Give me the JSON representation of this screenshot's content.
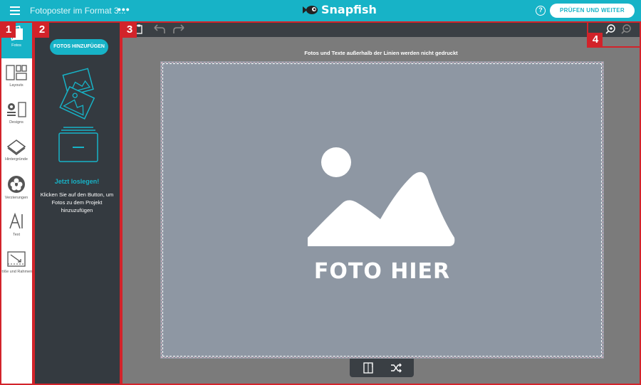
{
  "header": {
    "doc_title": "Fotoposter im Format 3...",
    "more": "•••",
    "brand": "Snapfish",
    "help": "?",
    "primary_button": "PRÜFEN UND WEITER"
  },
  "rail": {
    "items": [
      {
        "label": "Fotos",
        "icon": "photos-icon",
        "active": true
      },
      {
        "label": "Layouts",
        "icon": "layouts-icon"
      },
      {
        "label": "Designs",
        "icon": "designs-icon"
      },
      {
        "label": "Hintergründe",
        "icon": "backgrounds-icon"
      },
      {
        "label": "Verzierungen",
        "icon": "embellishments-icon"
      },
      {
        "label": "Text",
        "icon": "text-icon"
      },
      {
        "label": "röße und Rahmen",
        "icon": "size-frame-icon"
      }
    ]
  },
  "panel": {
    "add_button": "FOTOS HINZUFÜGEN",
    "heading": "Jetzt loslegen!",
    "text": "Klicken Sie auf den Button, um Fotos zu dem Projekt hinzuzufügen"
  },
  "canvas": {
    "notice": "Fotos und Texte außerhalb der Linien werden nicht gedruckt",
    "placeholder": "FOTO HIER"
  },
  "callouts": [
    "1",
    "2",
    "3",
    "4"
  ],
  "colors": {
    "accent": "#17b3c7",
    "panel_bg": "#343a40",
    "callout": "#d2232a",
    "poster": "#8e97a3"
  }
}
